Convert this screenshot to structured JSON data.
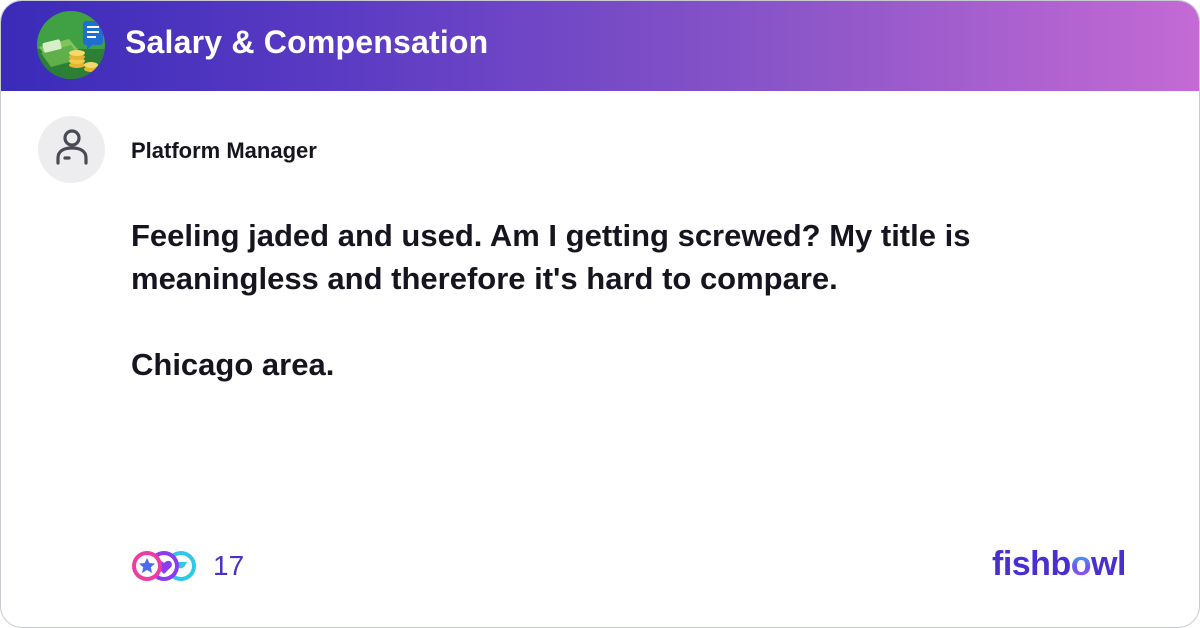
{
  "header": {
    "bowl_title": "Salary & Compensation",
    "logo_icon": "money-stack-with-chat-bubble-icon",
    "gradient_start": "#3a2bb8",
    "gradient_end": "#c46ad4"
  },
  "post": {
    "author_title": "Platform Manager",
    "avatar_icon": "anonymous-user-icon",
    "paragraphs": [
      "Feeling jaded and used. Am I getting screwed? My title is meaningless and therefore it's hard to compare.",
      "Chicago area."
    ]
  },
  "reactions": {
    "icons": [
      "star-reaction-icon",
      "heart-reaction-icon",
      "laugh-reaction-icon"
    ],
    "count": "17"
  },
  "brand": {
    "prefix": "fishb",
    "o": "o",
    "suffix": "wl",
    "color": "#4a2fd0"
  }
}
